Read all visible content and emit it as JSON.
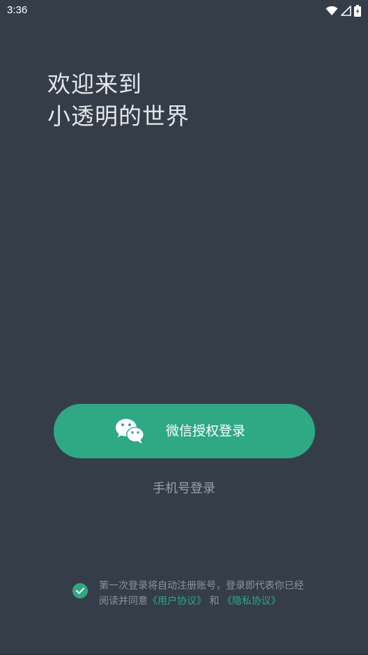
{
  "status_bar": {
    "time": "3:36",
    "icons": [
      "wifi-icon",
      "signal-icon",
      "battery-icon"
    ]
  },
  "welcome": {
    "line1": "欢迎来到",
    "line2": "小透明的世界"
  },
  "wechat_login": {
    "label": "微信授权登录",
    "icon": "wechat-icon"
  },
  "phone_login": {
    "label": "手机号登录"
  },
  "agreement": {
    "checked": true,
    "line1": "第一次登录将自动注册账号，登录即代表你已经",
    "line2_prefix": "阅读并同意",
    "user_agreement": "《用户协议》",
    "connector": "和",
    "privacy_agreement": "《隐私协议》"
  },
  "colors": {
    "background": "#353d48",
    "accent": "#2fa884",
    "title_text": "#e3e6ea",
    "muted_text": "#8c939d"
  }
}
